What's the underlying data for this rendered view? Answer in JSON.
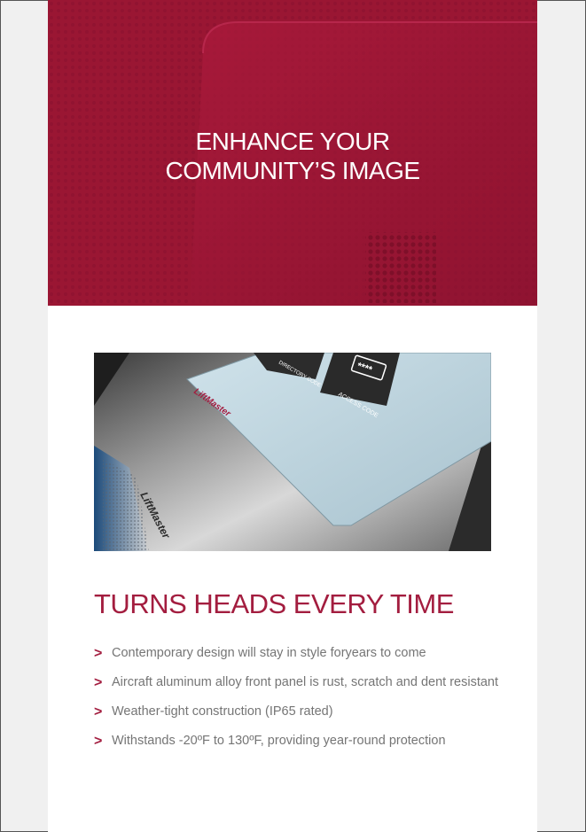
{
  "hero": {
    "title_line1": "ENHANCE YOUR",
    "title_line2": "COMMUNITY’S IMAGE"
  },
  "photo": {
    "brand_top": "LiftMaster",
    "brand_bottom": "LiftMaster",
    "directory_label": "DIRECTORY CODE",
    "access_code": "****",
    "access_label": "ACCESS CODE"
  },
  "section": {
    "headline": "TURNS HEADS EVERY TIME",
    "features": [
      "Contemporary design will stay in style foryears to come",
      "Aircraft aluminum alloy front panel is rust, scratch and dent resistant",
      "Weather-tight construction (IP65 rated)",
      "Withstands  -20ºF to 130ºF, providing year-round protection"
    ]
  },
  "colors": {
    "brand_red": "#9e1735",
    "headline_red": "#a31d3f",
    "body_gray": "#757575"
  },
  "icons": {
    "bullet": "chevron-right-icon"
  }
}
